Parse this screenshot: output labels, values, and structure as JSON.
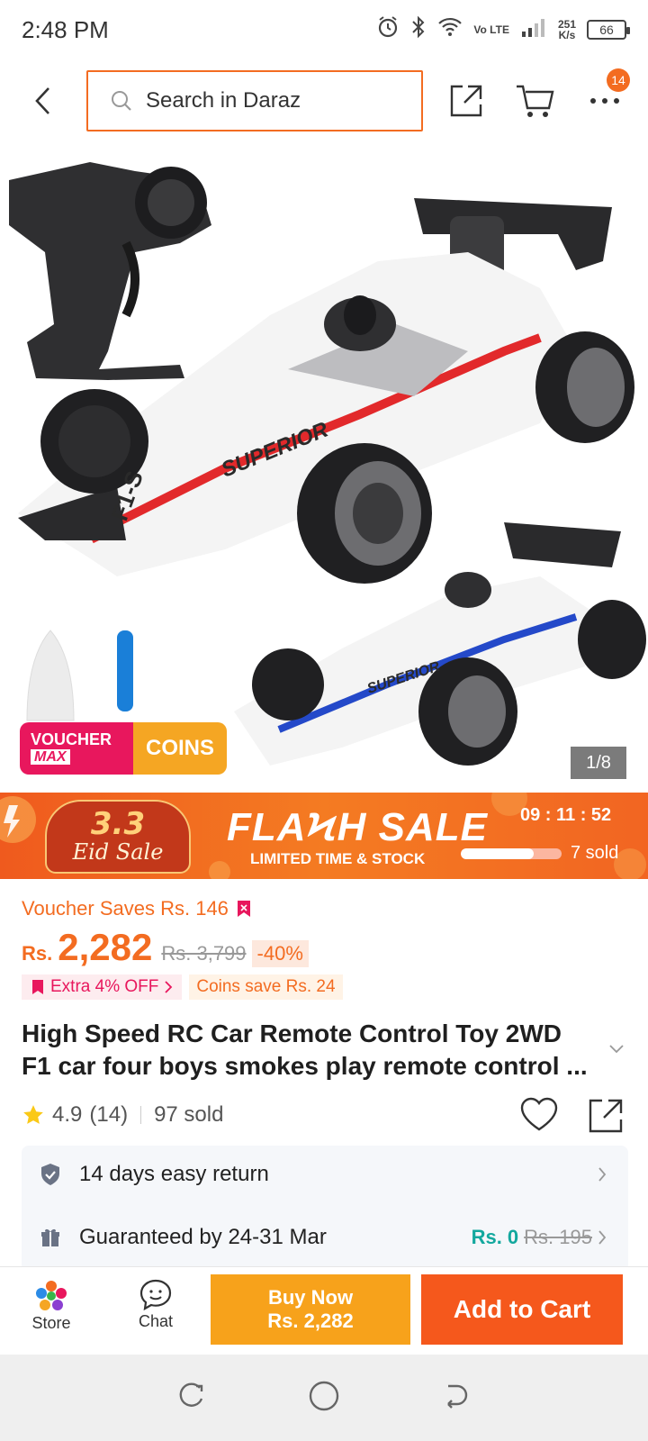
{
  "status_bar": {
    "time": "2:48 PM",
    "network": "Vo LTE",
    "speed_value": "251",
    "speed_unit": "K/s",
    "battery": "66"
  },
  "header": {
    "search_placeholder": "Search in Daraz",
    "more_badge": "14"
  },
  "product_image": {
    "voucher_label_top": "VOUCHER",
    "voucher_label_bottom": "MAX",
    "coins_label": "COINS",
    "counter": "1/8"
  },
  "flash_sale": {
    "campaign_number": "3.3",
    "campaign_name": "Eid Sale",
    "title": "FLAϞH SALE",
    "subtitle": "LIMITED TIME & STOCK",
    "timer": "09 : 11 : 52",
    "progress_fraction": 0.72,
    "sold": "7 sold"
  },
  "pricing": {
    "voucher_saves": "Voucher Saves Rs. 146",
    "currency": "Rs.",
    "price": "2,282",
    "original_price": "Rs. 3,799",
    "discount": "-40%",
    "extra_off": "Extra 4% OFF",
    "coins_save": "Coins save Rs. 24"
  },
  "product": {
    "title": "High Speed RC Car Remote Control Toy 2WD F1 car four boys smokes play remote control ...",
    "rating": "4.9",
    "reviews": "(14)",
    "sold": "97 sold"
  },
  "services": {
    "return_text": "14 days easy return",
    "delivery_text": "Guaranteed by 24-31 Mar",
    "delivery_fee": "Rs. 0",
    "delivery_old_fee": "Rs. 195"
  },
  "bottom_bar": {
    "store_label": "Store",
    "chat_label": "Chat",
    "buy_now_label": "Buy Now",
    "buy_now_price": "Rs. 2,282",
    "add_to_cart_label": "Add to Cart"
  },
  "colors": {
    "brand_orange": "#f36c21",
    "buy_now": "#f7a21b",
    "add_to_cart": "#f5581c",
    "voucher_pink": "#e8175d",
    "free_teal": "#13a89e"
  }
}
